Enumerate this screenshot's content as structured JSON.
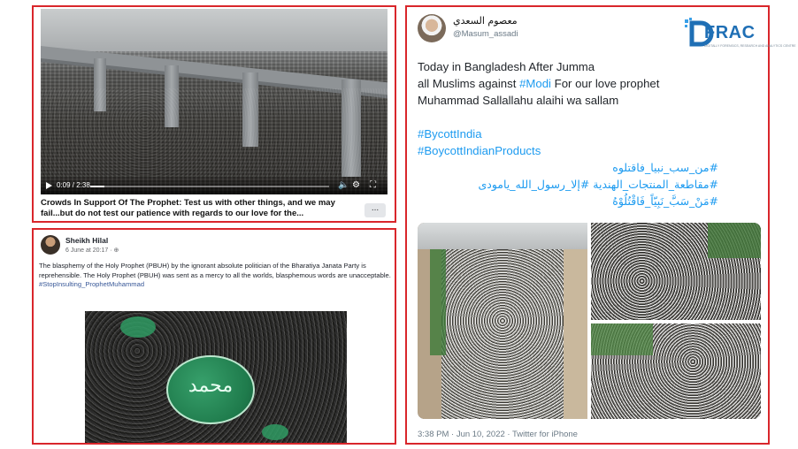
{
  "video_post": {
    "time": "0:09 / 2:38",
    "progress_fraction": 0.06,
    "caption": "Crowds In Support Of The Prophet: Test us with other things, and we may fail...but do not test our patience with regards to our love for the...",
    "more_label": "...",
    "controls": {
      "play": "play-icon",
      "settings": "gear-icon",
      "fullscreen": "fullscreen-icon",
      "volume": "volume-icon"
    }
  },
  "facebook_post": {
    "author": "Sheikh Hilal",
    "meta": "6 June at 20:17 · ⊕",
    "text": "The blasphemy of the Holy Prophet (PBUH) by the ignorant absolute politician of the Bharatiya Janata Party is reprehensible. The Holy Prophet (PBUH) was sent as a mercy to all the worlds, blasphemous words are unacceptable.",
    "hashtag": "#StopInsulting_ProphetMuhammad",
    "emblem_text": "محمد"
  },
  "tweet": {
    "name": "معصوم السعدي",
    "handle": "@Masum_assadi",
    "line1": "Today in Bangladesh After Jumma",
    "line2_prefix": "all Muslims against ",
    "line2_link": "#Modi",
    "line2_suffix": " For our love prophet",
    "line3": "Muhammad Sallallahu alaihi wa sallam",
    "hashtags": [
      "#BycottIndia",
      "#BoycottIndianProducts"
    ],
    "arabic_lines": [
      "#من_سب_نبيا_فاقتلوه",
      "#مقاطعة_المنتجات_الهندية #إلا_رسول_الله_يامودى",
      "#مَنْ_سَبَّ_نَبِيّاً_فَاقْتُلُوْهُ"
    ],
    "footer": "3:38 PM · Jun 10, 2022 · Twitter for iPhone"
  },
  "logo": {
    "text": "FRAC",
    "subtitle": "DIGITALLY FORENSICS, RESEARCH AND ANALYTICS CENTRE",
    "colors": {
      "primary": "#1f6fb5",
      "accent": "#3aa0e8"
    }
  },
  "colors": {
    "frame": "#d9262b",
    "link": "#1d9bf0",
    "fb_link": "#385898"
  }
}
